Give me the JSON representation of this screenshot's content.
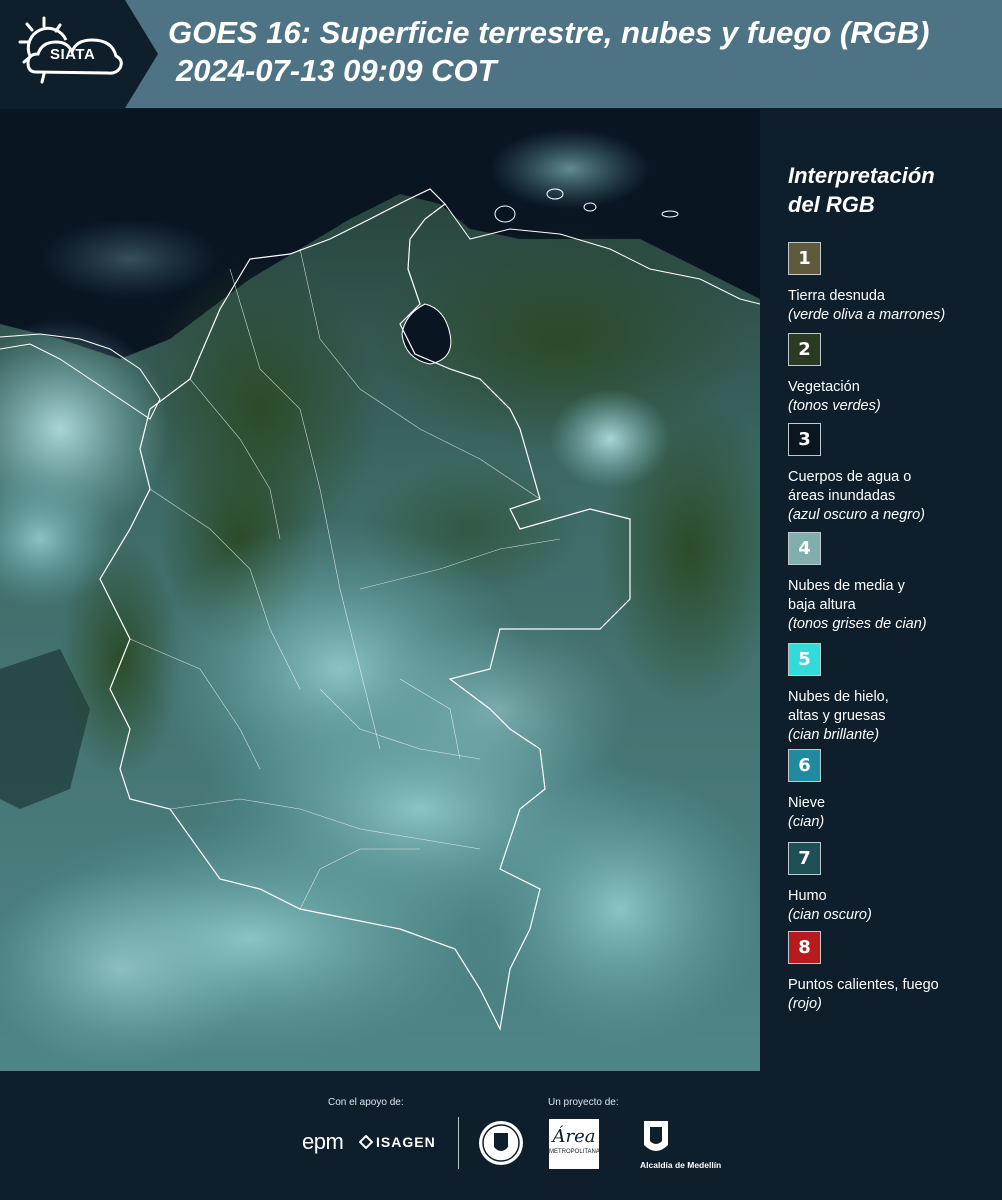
{
  "header": {
    "brand": "SIATA",
    "title_line1": "GOES 16: Superficie terrestre, nubes y fuego (RGB)",
    "title_line2": "2024-07-13 09:09 COT"
  },
  "map": {
    "image_description_icon": "satellite-rgb-map"
  },
  "legend": {
    "title_line1": "Interpretación",
    "title_line2": "del RGB",
    "items": [
      {
        "number": "1",
        "label": "Tierra desnuda",
        "desc": "(verde oliva a marrones)",
        "color": "#5f5a3e"
      },
      {
        "number": "2",
        "label": "Vegetación",
        "desc": "(tonos verdes)",
        "color": "#2a3b22"
      },
      {
        "number": "3",
        "label": "Cuerpos de agua o áreas inundadas",
        "label_line1": "Cuerpos de agua o",
        "label_line2": "áreas inundadas",
        "desc": "(azul oscuro a negro)",
        "color": "#0b1621"
      },
      {
        "number": "4",
        "label": "Nubes de media y baja altura",
        "label_line1": "Nubes de media y",
        "label_line2": "baja altura",
        "desc": "(tonos grises de cian)",
        "color": "#82aeae"
      },
      {
        "number": "5",
        "label": "Nubes de hielo, altas y gruesas",
        "label_line1": "Nubes de hielo,",
        "label_line2": "altas y gruesas",
        "desc": "(cian brillante)",
        "color": "#33dada"
      },
      {
        "number": "6",
        "label": "Nieve",
        "desc": "(cian)",
        "color": "#1f8aa0"
      },
      {
        "number": "7",
        "label": "Humo",
        "desc": "(cian oscuro)",
        "color": "#1f4f55"
      },
      {
        "number": "8",
        "label": "Puntos calientes, fuego",
        "desc": "(rojo)",
        "color": "#b71c1c"
      }
    ]
  },
  "footer": {
    "support_label": "Con el apoyo de:",
    "project_label": "Un proyecto de:",
    "epm": "epm",
    "isagen": "ISAGEN",
    "area_logo_text": "Área",
    "area_logo_sub": "METROPOLITANA",
    "alcaldia": "Alcaldía de Medellín"
  }
}
